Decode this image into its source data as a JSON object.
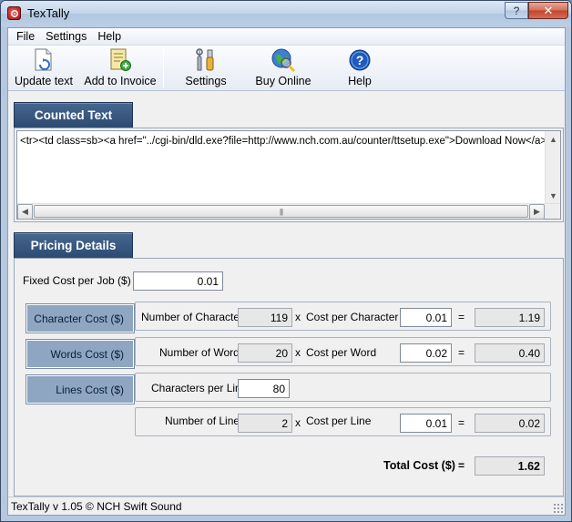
{
  "window": {
    "title": "TexTally"
  },
  "menu": [
    "File",
    "Settings",
    "Help"
  ],
  "toolbar": {
    "update_text": "Update text",
    "add_to_invoice": "Add to Invoice",
    "settings": "Settings",
    "buy_online": "Buy Online",
    "help": "Help"
  },
  "counted_text": {
    "heading": "Counted Text",
    "content": "<tr><td class=sb><a href=\"../cgi-bin/dld.exe?file=http://www.nch.com.au/counter/ttsetup.exe\">Download Now</a></td>"
  },
  "pricing": {
    "heading": "Pricing Details",
    "fixed_cost_label": "Fixed Cost per Job ($)",
    "fixed_cost_value": "0.01",
    "character_cost_btn": "Character Cost ($)",
    "words_cost_btn": "Words Cost ($)",
    "lines_cost_btn": "Lines Cost ($)",
    "characters": {
      "count_label": "Number of Characters",
      "count": "119",
      "times": "x",
      "rate_label": "Cost per Character",
      "rate": "0.01",
      "equals": "=",
      "total": "1.19"
    },
    "words": {
      "count_label": "Number of Words",
      "count": "20",
      "times": "x",
      "rate_label": "Cost per Word",
      "rate": "0.02",
      "equals": "=",
      "total": "0.40"
    },
    "chars_per_line_label": "Characters per Line",
    "chars_per_line": "80",
    "lines": {
      "count_label": "Number of Lines",
      "count": "2",
      "times": "x",
      "rate_label": "Cost per Line",
      "rate": "0.01",
      "equals": "=",
      "total": "0.02"
    },
    "total_label": "Total Cost ($)",
    "total_equals": "=",
    "total_value": "1.62"
  },
  "status": "TexTally v 1.05 © NCH Swift Sound"
}
